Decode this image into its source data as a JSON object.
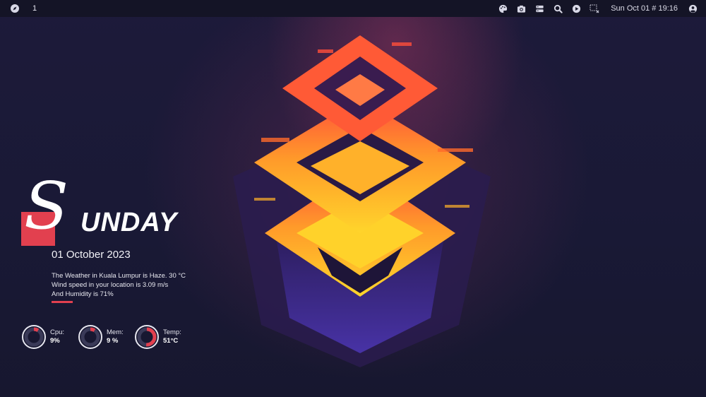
{
  "topbar": {
    "workspace": "1",
    "clock": "Sun Oct 01 # 19:16",
    "icons": [
      "compass-icon",
      "palette-icon",
      "camera-icon",
      "server-icon",
      "search-icon",
      "play-icon",
      "screen-record-icon",
      "user-icon"
    ]
  },
  "widget": {
    "day_initial": "S",
    "day_rest": "UNDAY",
    "date": "01 October 2023",
    "weather_lines": [
      "The Weather in Kuala Lumpur is Haze. 30 °C",
      "Wind speed in your location is 3.09 m/s",
      "And Humidity is 71%"
    ],
    "accent_color": "#e2404f",
    "gauges": [
      {
        "label": "Cpu:",
        "value": "9%",
        "fraction": 0.09
      },
      {
        "label": "Mem:",
        "value": "9 %",
        "fraction": 0.09
      },
      {
        "label": "Temp:",
        "value": "51°C",
        "fraction": 0.51
      }
    ]
  },
  "colors": {
    "background": "#1b1a38",
    "topbar": "#141426",
    "accent": "#e2404f",
    "art_orange": "#ff6a2b",
    "art_yellow": "#ffd229",
    "art_purple": "#4a2fa0"
  }
}
